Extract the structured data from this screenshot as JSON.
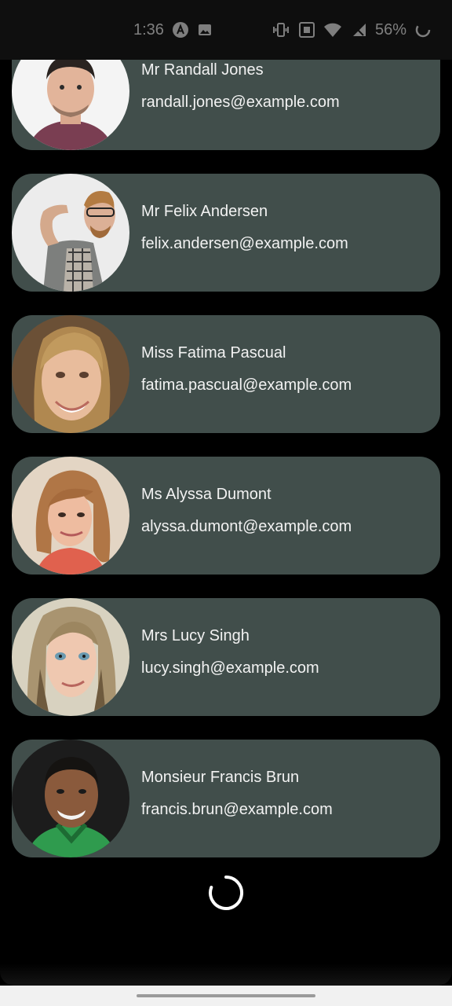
{
  "status_bar": {
    "time": "1:36",
    "battery_percent": "56%",
    "icons": [
      "a-badge-icon",
      "image-icon",
      "vibrate-icon",
      "nfc-icon",
      "wifi-icon",
      "signal-icon",
      "battery-saver-icon"
    ]
  },
  "users": [
    {
      "name": "Mr Randall Jones",
      "email": "randall.jones@example.com"
    },
    {
      "name": "Mr Felix Andersen",
      "email": "felix.andersen@example.com"
    },
    {
      "name": "Miss Fatima Pascual",
      "email": "fatima.pascual@example.com"
    },
    {
      "name": "Ms Alyssa Dumont",
      "email": "alyssa.dumont@example.com"
    },
    {
      "name": "Mrs Lucy Singh",
      "email": "lucy.singh@example.com"
    },
    {
      "name": "Monsieur Francis Brun",
      "email": "francis.brun@example.com"
    }
  ],
  "colors": {
    "card_background": "#414e4b",
    "screen_background": "#000000",
    "text": "#f2f2f2"
  },
  "loading": true
}
